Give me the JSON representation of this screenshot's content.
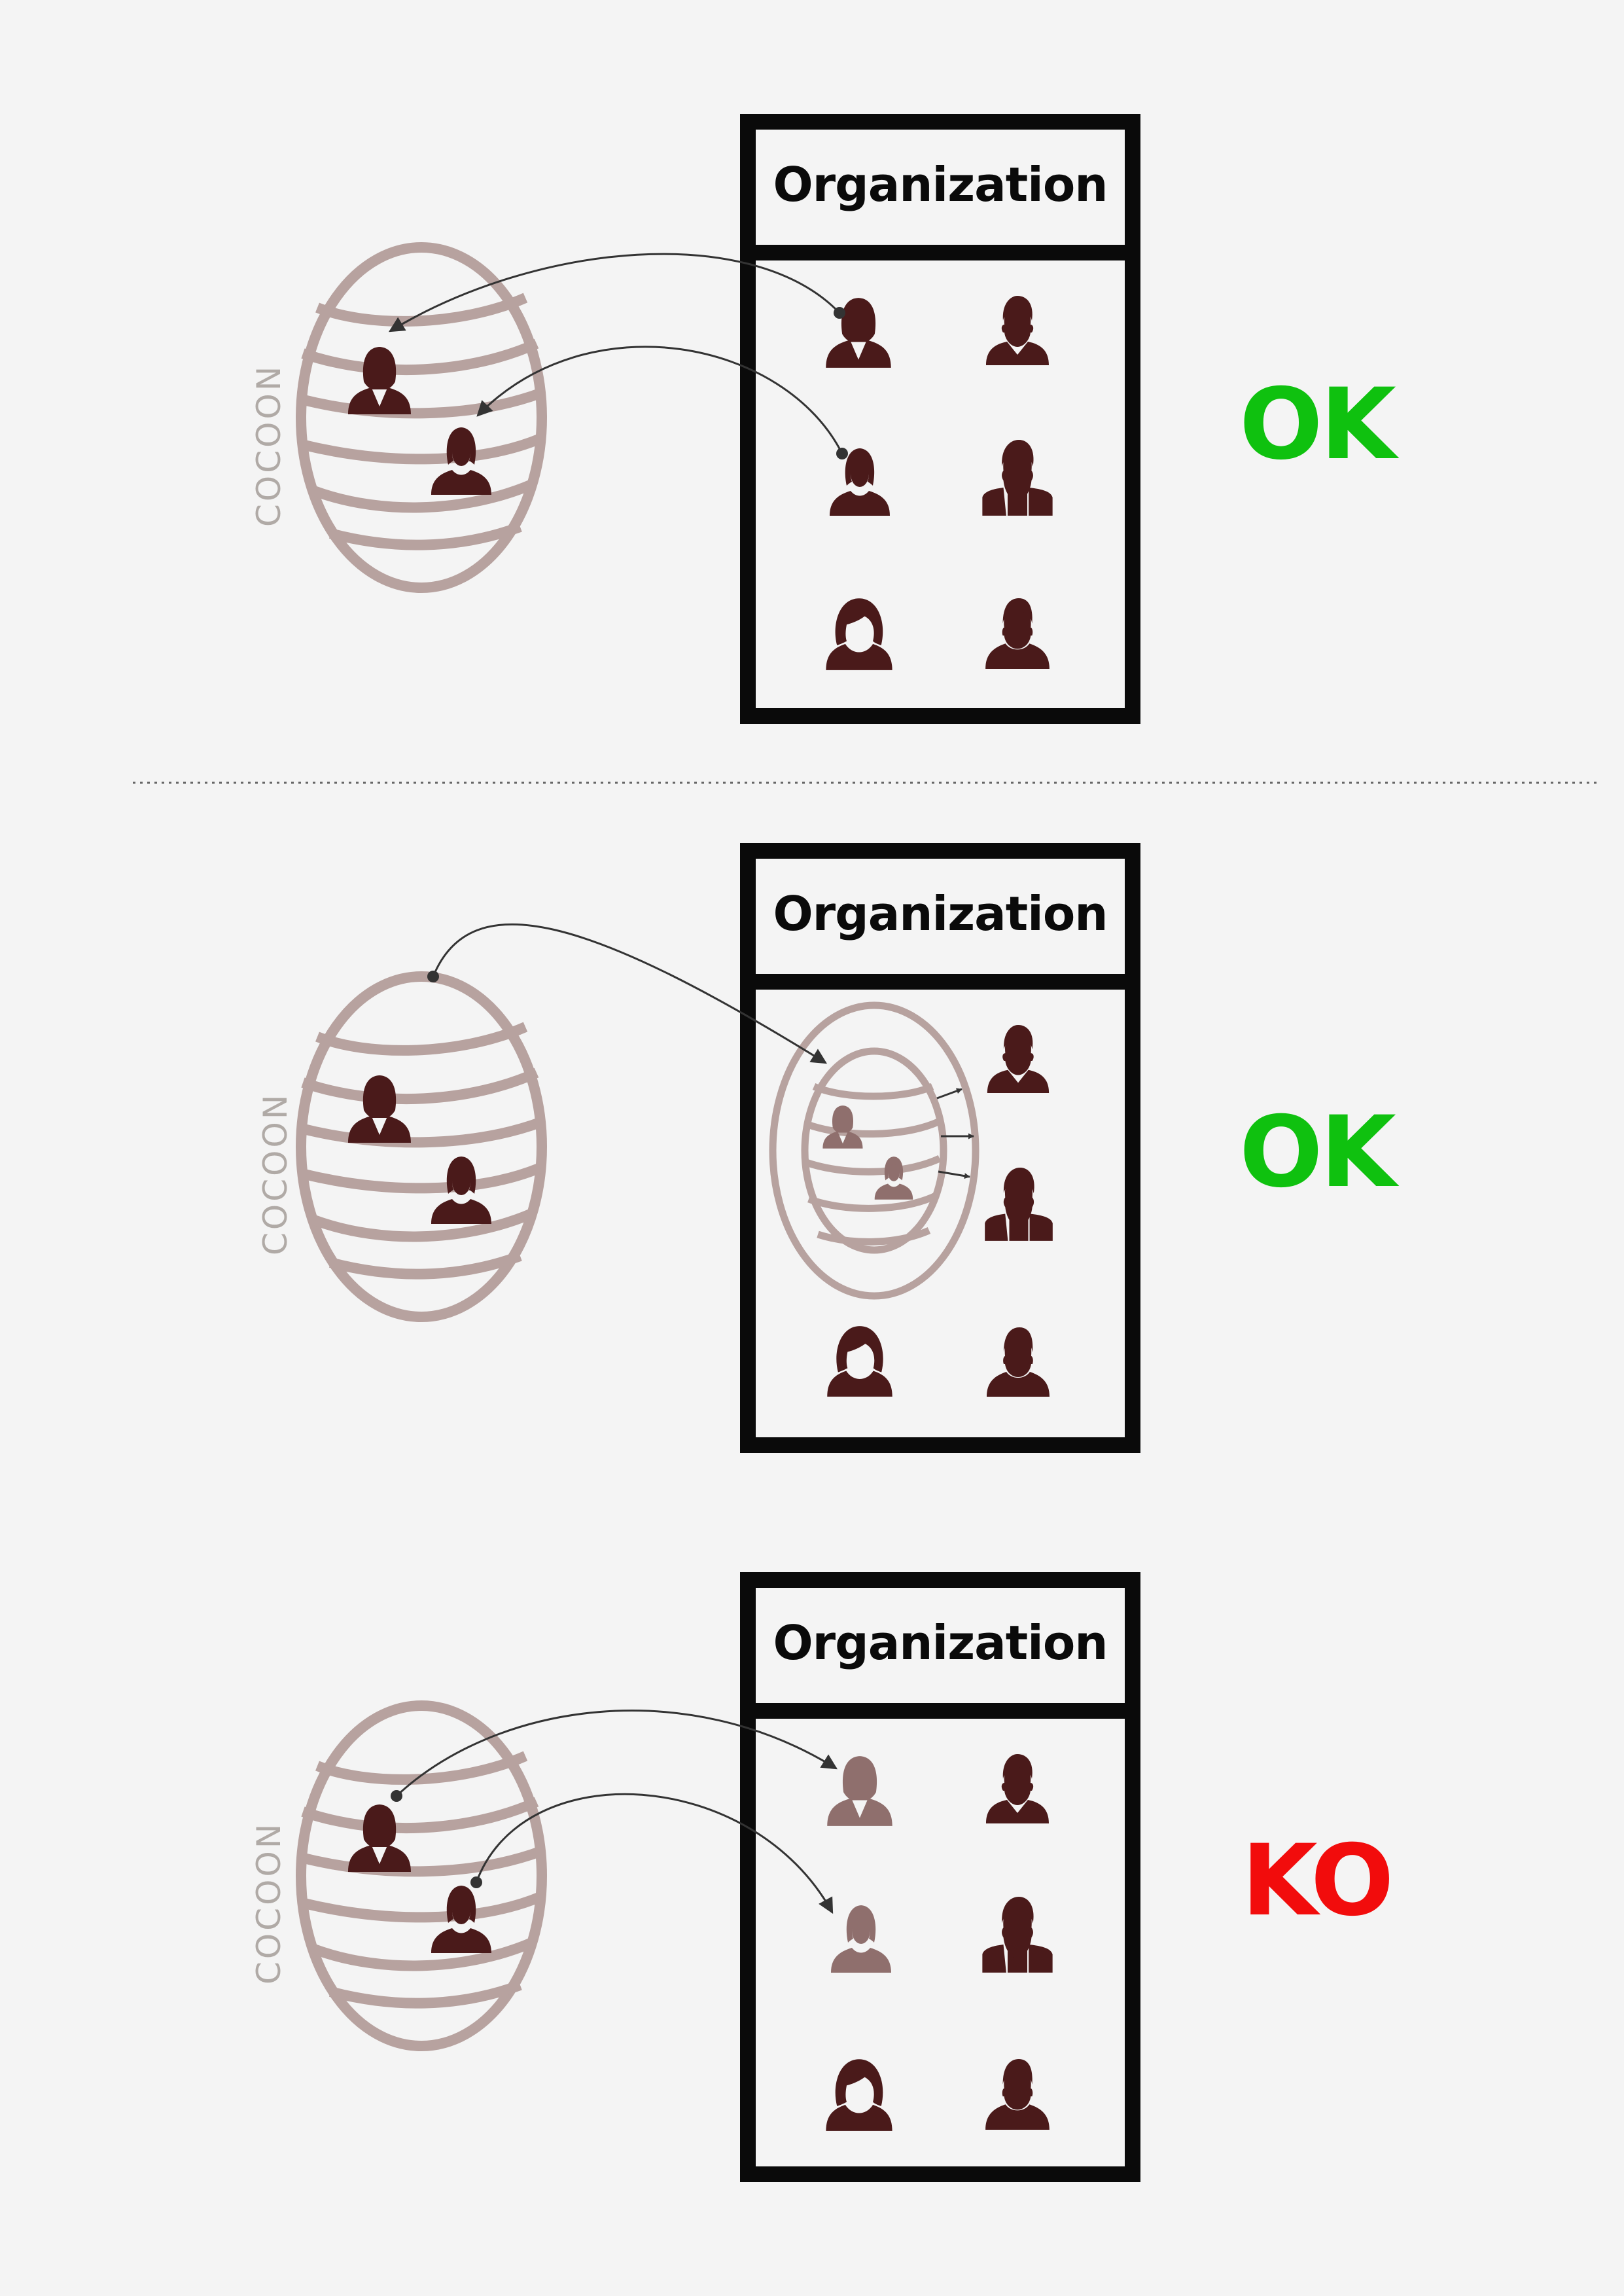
{
  "colors": {
    "background": "#f4f4f4",
    "frame": "#0a0a0a",
    "cocoon": "#b7a29f",
    "person": "#4a1a1a",
    "person_faded": "#8f6f6d",
    "connector": "#333333",
    "ok": "#0fc10f",
    "ko": "#f20c0c"
  },
  "icons": {
    "female": "female-person-icon",
    "male": "male-person-icon",
    "bearded": "bearded-person-icon"
  },
  "panels": [
    {
      "id": "panel-1",
      "org_label": "Organization",
      "cocoon_label": "COCOON",
      "verdict": "OK",
      "verdict_color": "ok"
    },
    {
      "id": "panel-2",
      "org_label": "Organization",
      "cocoon_label": "COCOON",
      "verdict": "OK",
      "verdict_color": "ok"
    },
    {
      "id": "panel-3",
      "org_label": "Organization",
      "cocoon_label": "COCOON",
      "verdict": "KO",
      "verdict_color": "ko"
    }
  ]
}
